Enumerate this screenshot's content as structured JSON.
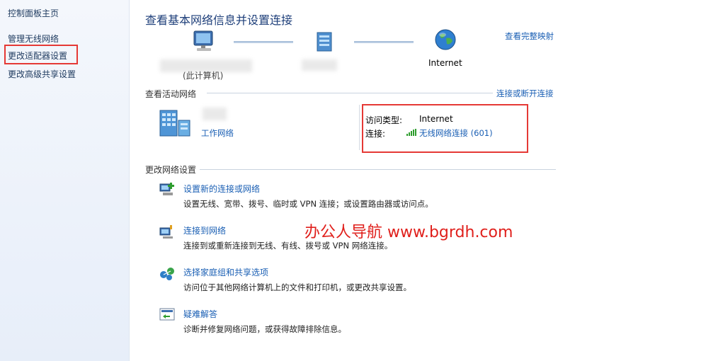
{
  "sidebar": {
    "home": "控制面板主页",
    "items": [
      "管理无线网络",
      "更改适配器设置",
      "更改高级共享设置"
    ]
  },
  "header": {
    "title": "查看基本网络信息并设置连接",
    "map_link": "查看完整映射"
  },
  "network_map": {
    "pc_label": "(此计算机)",
    "internet_label": "Internet"
  },
  "active_networks": {
    "section_label": "查看活动网络",
    "connect_link": "连接或断开连接",
    "network_type": "工作网络",
    "access_type_label": "访问类型:",
    "access_type_value": "Internet",
    "connection_label": "连接:",
    "connection_value": "无线网络连接 (601)"
  },
  "change_settings": {
    "section_label": "更改网络设置",
    "tasks": [
      {
        "title": "设置新的连接或网络",
        "desc": "设置无线、宽带、拨号、临时或 VPN 连接；或设置路由器或访问点。"
      },
      {
        "title": "连接到网络",
        "desc": "连接到或重新连接到无线、有线、拨号或 VPN 网络连接。"
      },
      {
        "title": "选择家庭组和共享选项",
        "desc": "访问位于其他网络计算机上的文件和打印机，或更改共享设置。"
      },
      {
        "title": "疑难解答",
        "desc": "诊断并修复网络问题，或获得故障排除信息。"
      }
    ]
  },
  "watermark": "办公人导航 www.bgrdh.com",
  "colors": {
    "link": "#1a5fb4",
    "title": "#1e3f7a",
    "highlight": "#e53935",
    "watermark": "#e0201c"
  }
}
